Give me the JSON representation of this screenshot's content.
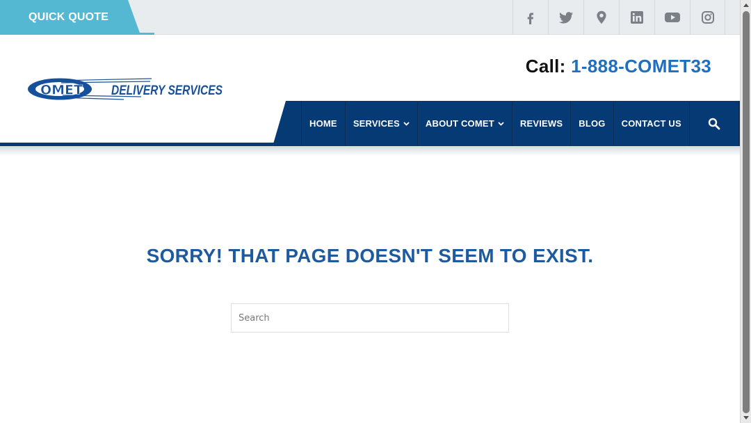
{
  "topbar": {
    "quick_quote": "QUICK QUOTE",
    "social": [
      {
        "icon": "facebook-icon"
      },
      {
        "icon": "twitter-icon"
      },
      {
        "icon": "location-pin-icon"
      },
      {
        "icon": "linkedin-icon"
      },
      {
        "icon": "youtube-icon"
      },
      {
        "icon": "instagram-icon"
      }
    ]
  },
  "header": {
    "call_label": "Call:",
    "phone": "1-888-COMET33",
    "logo_text_main": "OMET",
    "logo_text_sub": "DELIVERY SERVICES"
  },
  "nav": {
    "home": "HOME",
    "services": "SERVICES",
    "about": "ABOUT COMET",
    "reviews": "REVIEWS",
    "blog": "BLOG",
    "contact": "CONTACT US"
  },
  "main": {
    "title": "SORRY! THAT PAGE DOESN'T SEEM TO EXIST.",
    "search_placeholder": "Search"
  },
  "colors": {
    "nav_blue": "#063a75",
    "accent_cyan": "#55b8d3",
    "title_blue": "#1d5aa0",
    "phone_blue": "#1f6fc0",
    "icon_gray": "#7b8087"
  }
}
